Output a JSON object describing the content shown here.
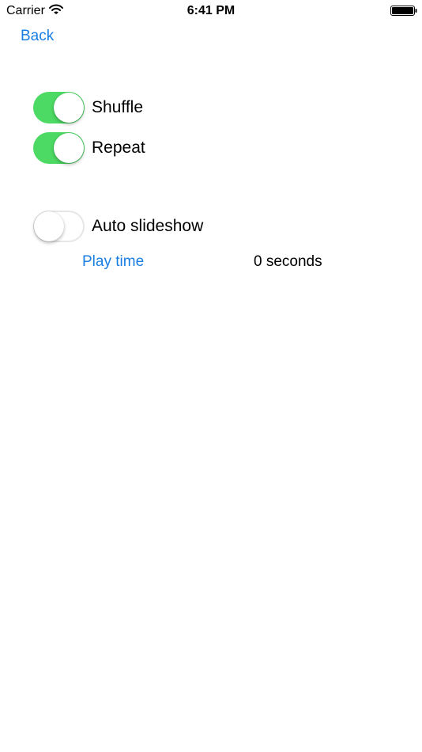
{
  "status_bar": {
    "carrier": "Carrier",
    "time": "6:41 PM",
    "wifi_icon": "wifi-icon",
    "battery_icon": "battery-full-icon"
  },
  "nav": {
    "back_label": "Back"
  },
  "settings": {
    "shuffle": {
      "label": "Shuffle",
      "on": true
    },
    "repeat": {
      "label": "Repeat",
      "on": true
    },
    "auto_slideshow": {
      "label": "Auto slideshow",
      "on": false
    }
  },
  "play_time": {
    "label": "Play time",
    "value": "0 seconds"
  },
  "colors": {
    "accent": "#1a7ee3",
    "toggle_on": "#4cd964",
    "toggle_off_border": "#e6e6e6"
  }
}
